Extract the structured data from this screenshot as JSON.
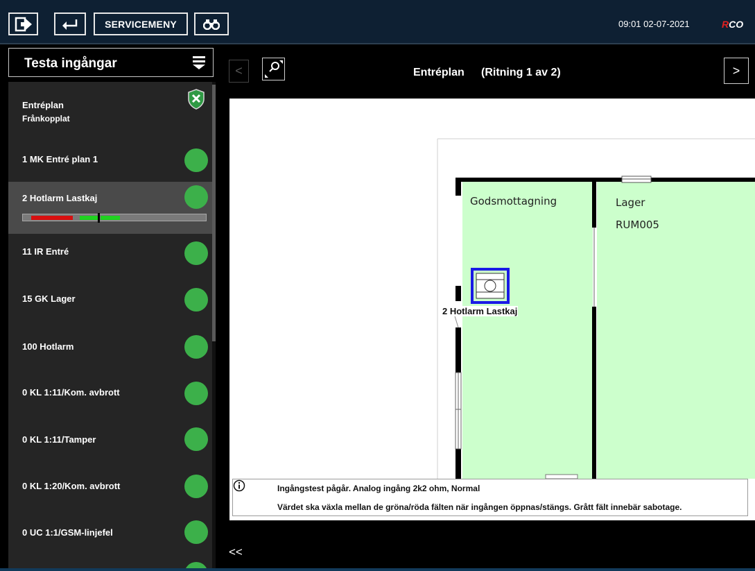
{
  "topbar": {
    "service_label": "SERVICEMENY",
    "clock": "09:01  02-07-2021",
    "brand_r": "R",
    "brand_co": "CO"
  },
  "panel": {
    "title": "Testa ingångar",
    "header_item": {
      "label": "Entréplan",
      "sublabel": "Frånkopplat"
    },
    "items": [
      {
        "label": "1 MK Entré plan 1",
        "status": "ok"
      },
      {
        "label": "2 Hotlarm Lastkaj",
        "status": "ok",
        "selected": true
      },
      {
        "label": "11 IR Entré",
        "status": "ok"
      },
      {
        "label": "15 GK Lager",
        "status": "ok"
      },
      {
        "label": "100 Hotlarm",
        "status": "ok"
      },
      {
        "label": "0 KL 1:11/Kom. avbrott",
        "status": "ok"
      },
      {
        "label": "0 KL 1:11/Tamper",
        "status": "ok"
      },
      {
        "label": "0 KL 1:20/Kom. avbrott",
        "status": "ok"
      },
      {
        "label": "0 UC 1:1/GSM-linjefel",
        "status": "ok"
      }
    ]
  },
  "main": {
    "plan_name": "Entréplan",
    "plan_index": "(Ritning 1 av 2)",
    "prev_label": "<",
    "next_label": ">",
    "rooms": {
      "room1": "Godsmottagning",
      "room2_name": "Lager",
      "room2_id": "RUM005"
    },
    "device_label": "2 Hotlarm Lastkaj",
    "info_line1": "Ingångstest pågår.  Analog ingång 2k2 ohm,  Normal",
    "info_line2": "Värdet ska växla mellan de gröna/röda fälten när ingången öppnas/stängs. Grått fält innebär sabotage.",
    "collapse_label": "<<"
  },
  "colors": {
    "topbar_bg": "#0e2033",
    "status_ok": "#3cb04a",
    "room_fill": "#ccffcc",
    "device_frame": "#1a1ae6",
    "bar_red": "#d80f0f",
    "bar_green": "#20d320"
  }
}
